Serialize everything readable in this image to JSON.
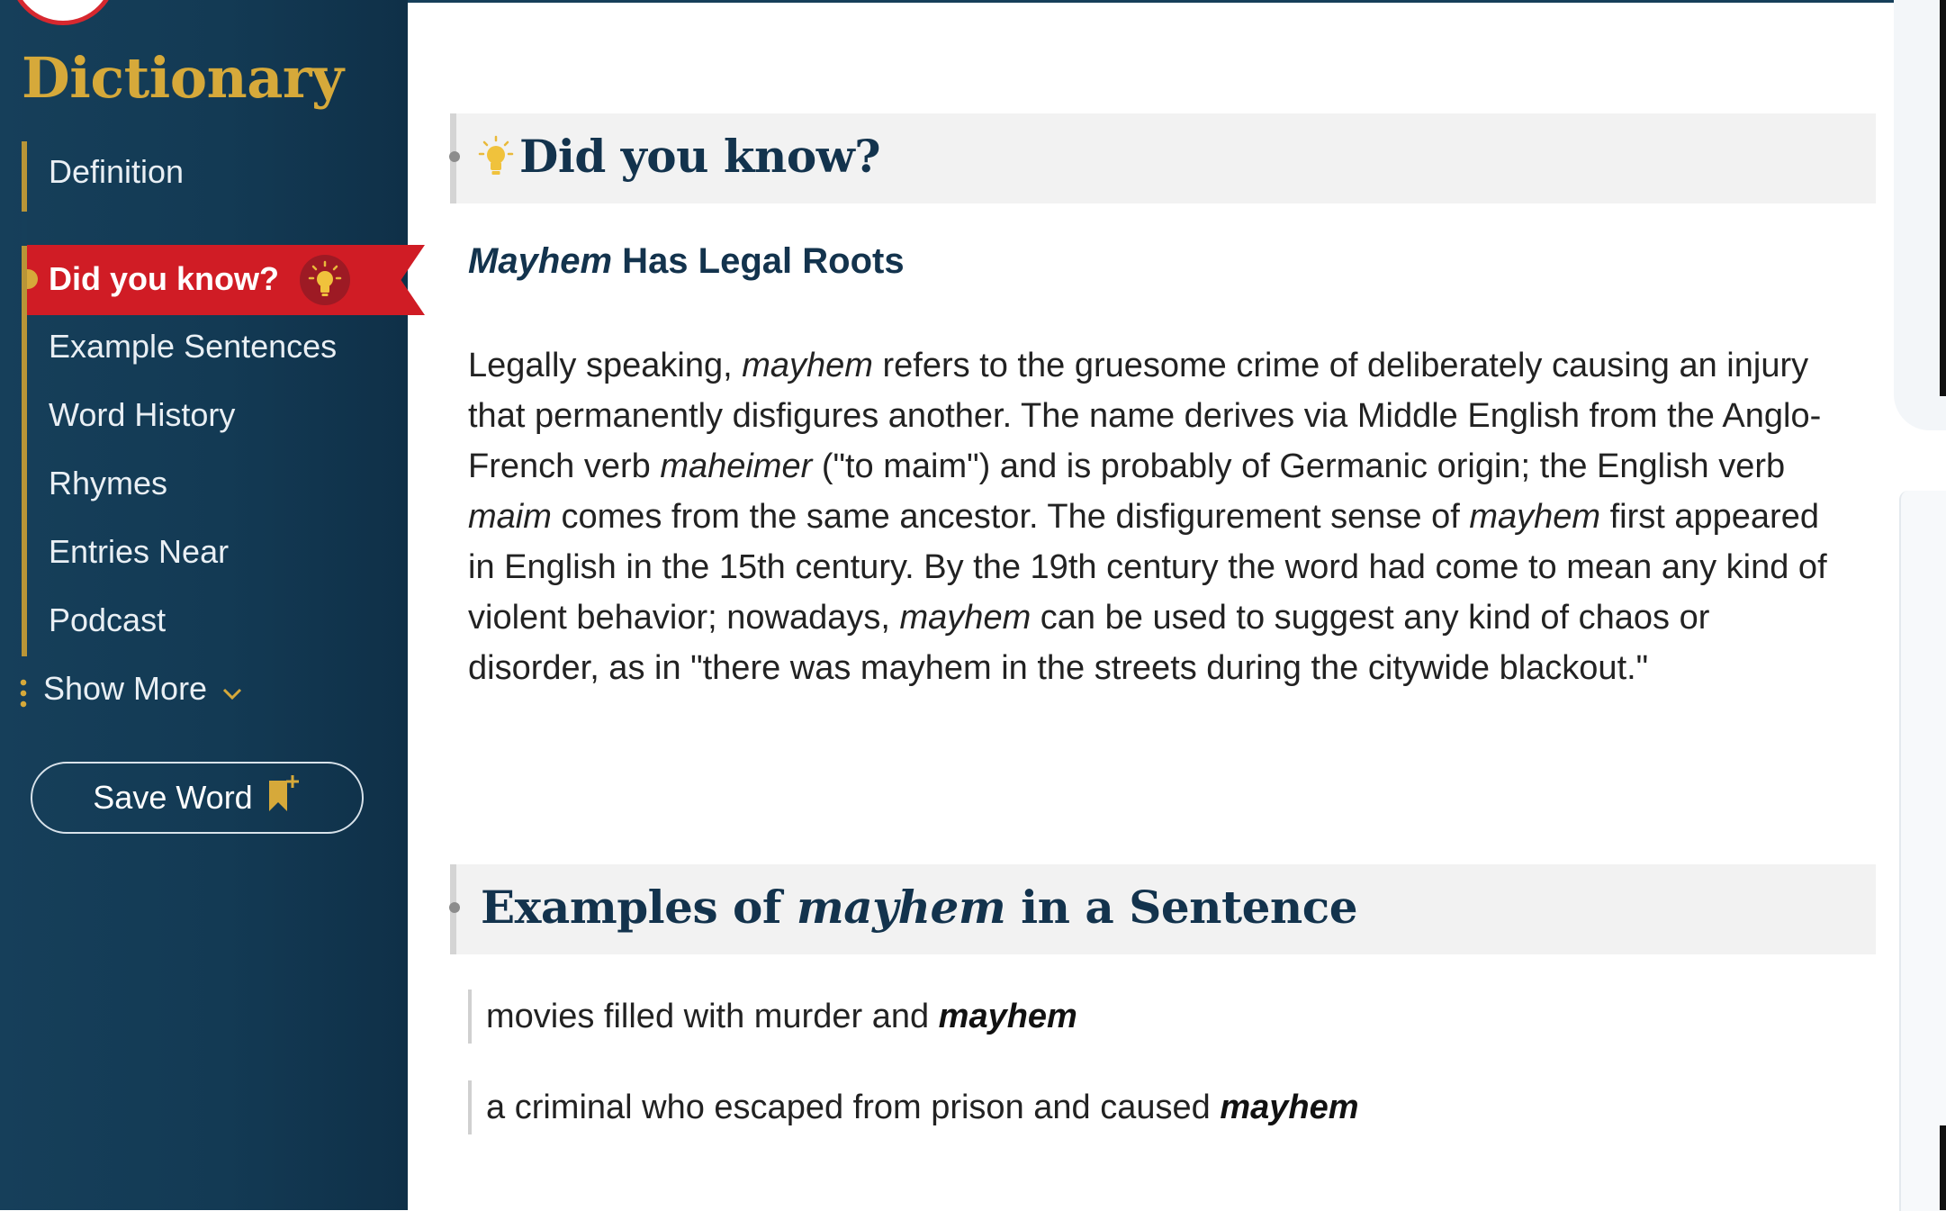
{
  "sidebar": {
    "brand": "Dictionary",
    "nav": [
      {
        "label": "Definition",
        "active": false
      },
      {
        "label": "Did you know?",
        "active": true
      },
      {
        "label": "Example Sentences",
        "active": false
      },
      {
        "label": "Word History",
        "active": false
      },
      {
        "label": "Rhymes",
        "active": false
      },
      {
        "label": "Entries Near",
        "active": false
      },
      {
        "label": "Podcast",
        "active": false
      }
    ],
    "show_more": "Show More",
    "save_word": "Save Word"
  },
  "did_you_know": {
    "heading": "Did you know?",
    "subhead_word": "Mayhem",
    "subhead_rest": " Has Legal Roots",
    "paragraph": [
      {
        "t": "Legally speaking, "
      },
      {
        "i": "mayhem"
      },
      {
        "t": " refers to the gruesome crime of deliberately causing an injury that permanently disfigures another. The name derives via Middle English from the Anglo-French verb "
      },
      {
        "i": "maheimer"
      },
      {
        "t": " (\"to maim\") and is probably of Germanic origin; the English verb "
      },
      {
        "i": "maim"
      },
      {
        "t": " comes from the same ancestor. The disfigurement sense of "
      },
      {
        "i": "mayhem"
      },
      {
        "t": " first appeared in English in the 15th century. By the 19th century the word had come to mean any kind of violent behavior; nowadays, "
      },
      {
        "i": "mayhem"
      },
      {
        "t": " can be used to suggest any kind of chaos or disorder, as in \"there was mayhem in the streets during the citywide blackout.\""
      }
    ]
  },
  "examples": {
    "heading_pre": "Examples of ",
    "heading_word": "mayhem",
    "heading_post": " in a Sentence",
    "items": [
      {
        "text": "movies filled with murder and ",
        "word": "mayhem"
      },
      {
        "text": "a criminal who escaped from prison and caused ",
        "word": "mayhem"
      }
    ]
  },
  "colors": {
    "sidebar_bg": "#163f5a",
    "brand_gold": "#d6a93a",
    "active_red": "#d01c25",
    "heading_navy": "#13334d"
  },
  "icons": [
    "lightbulb-icon",
    "chevron-down-icon",
    "bookmark-plus-icon"
  ]
}
